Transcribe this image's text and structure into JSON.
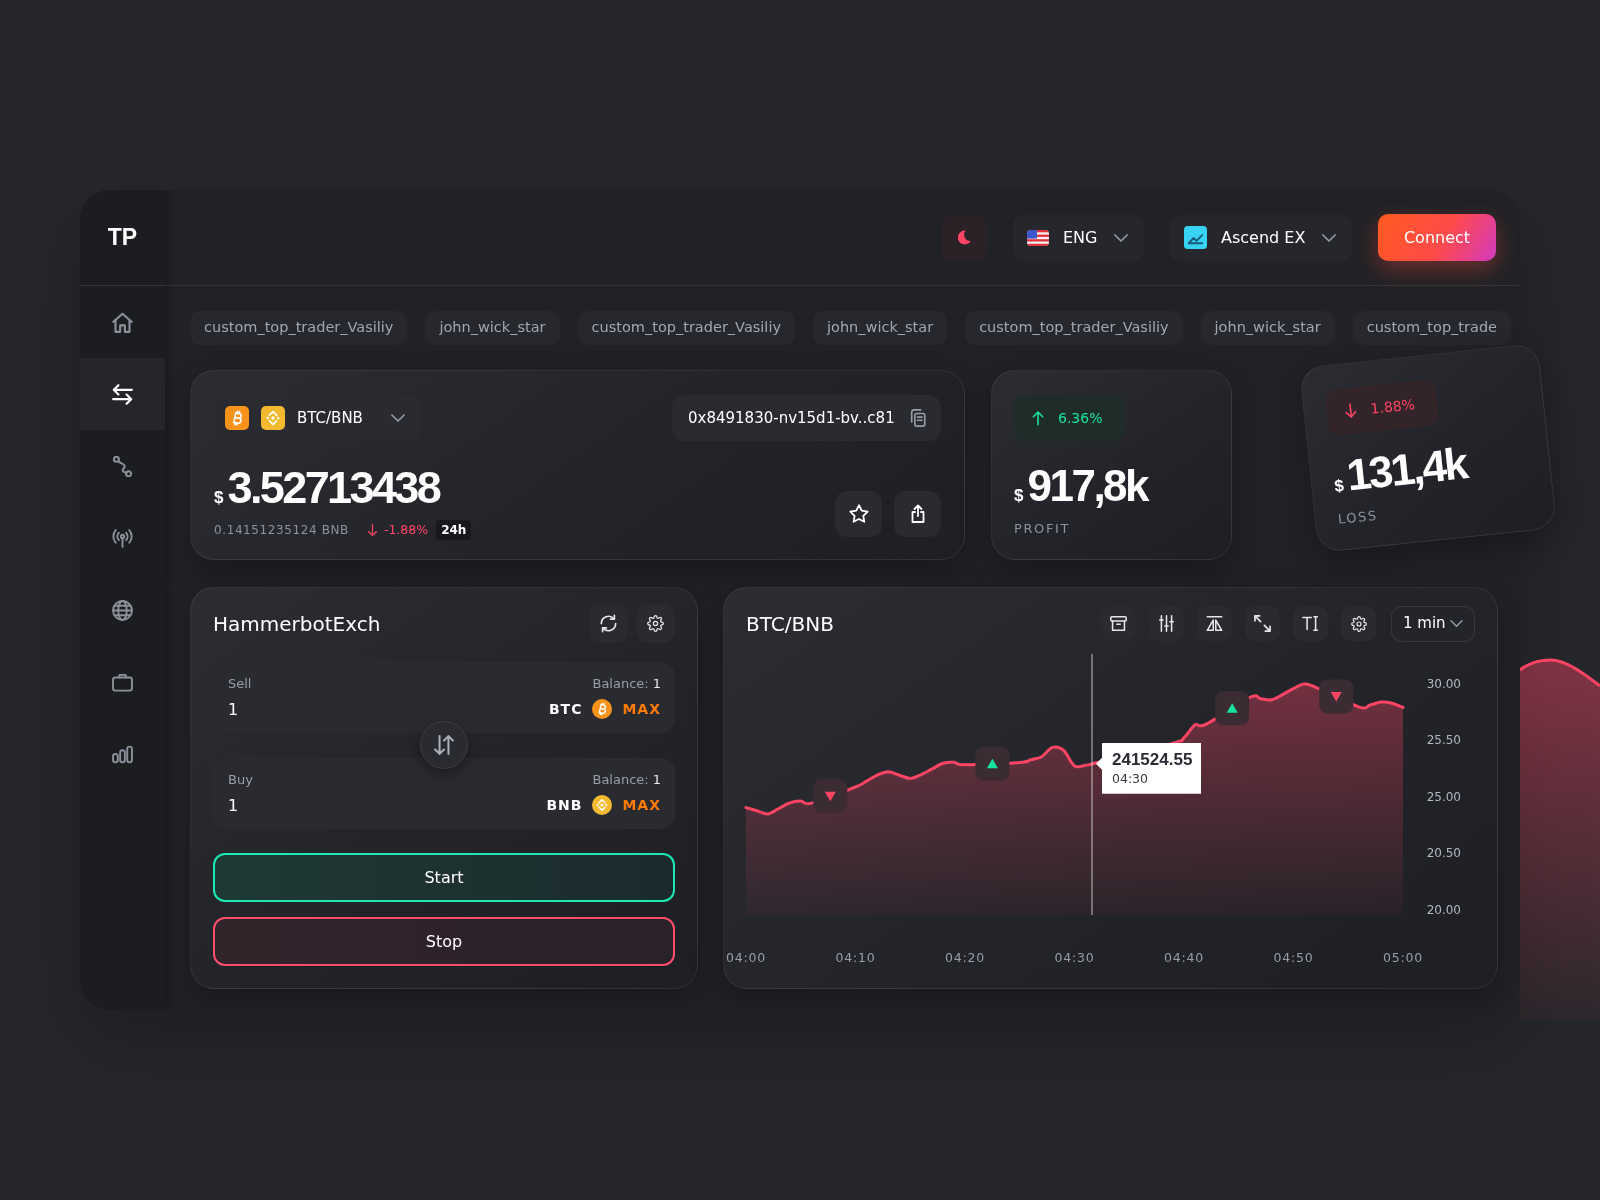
{
  "sidebar": {
    "logo": "TP",
    "items": [
      {
        "selected": false
      },
      {
        "selected": true
      },
      {
        "selected": false
      },
      {
        "selected": false
      },
      {
        "selected": false
      },
      {
        "selected": false
      },
      {
        "selected": false
      }
    ]
  },
  "header": {
    "language": "ENG",
    "exchange": "Ascend EX",
    "connect": "Connect"
  },
  "tags": [
    "custom_top_trader_Vasiliy",
    "john_wick_star",
    "custom_top_trader_Vasiliy",
    "john_wick_star",
    "custom_top_trader_Vasiliy",
    "john_wick_star",
    "custom_top_trade"
  ],
  "price_card": {
    "pair": "BTC/BNB",
    "address": "0x8491830-nv15d1-bv..c81",
    "currency": "$",
    "price": "3.52713438",
    "converted": "0.14151235124 BNB",
    "rising": false,
    "change": "-1.88%",
    "period": "24h"
  },
  "stats": [
    {
      "rising": true,
      "change": "6.36%",
      "currency": "$",
      "value": "917,8k",
      "label": "PROFIT",
      "tilted": false
    },
    {
      "rising": false,
      "change": "1.88%",
      "currency": "$",
      "value": "131,4k",
      "label": "LOSS",
      "tilted": true
    }
  ],
  "bot": {
    "title": "HammerbotExch",
    "fields": [
      {
        "label": "Sell",
        "balance_label": "Balance:",
        "balance": "1",
        "value": "1",
        "token": "BTC",
        "max": "MAX"
      },
      {
        "label": "Buy",
        "balance_label": "Balance:",
        "balance": "1",
        "value": "1",
        "token": "BNB",
        "max": "MAX"
      }
    ],
    "buttons": [
      {
        "label": "Start",
        "kind": "success"
      },
      {
        "label": "Stop",
        "kind": "danger"
      }
    ]
  },
  "chart": {
    "interval": "1 min",
    "y_between_labels": [
      "25.50",
      "20.50"
    ],
    "tooltip": {
      "value": "241524.55",
      "time": "04:30"
    },
    "markers": [
      {
        "rising": false
      },
      {
        "rising": true
      },
      {
        "rising": true
      },
      {
        "rising": false
      }
    ],
    "chart_data": {
      "type": "area",
      "title": "BTC/BNB",
      "categories": [
        "04:00",
        null,
        null,
        null,
        null,
        null,
        null,
        null,
        null,
        null,
        "04:10",
        null,
        null,
        null,
        null,
        null,
        null,
        null,
        null,
        null,
        "04:20",
        null,
        null,
        null,
        null,
        null,
        null,
        null,
        null,
        null,
        "04:30",
        null,
        null,
        null,
        null,
        null,
        null,
        null,
        null,
        null,
        "04:40",
        null,
        null,
        null,
        null,
        null,
        null,
        null,
        null,
        null,
        "04:50",
        null,
        null,
        null,
        null,
        null,
        null,
        null,
        null,
        null,
        "05:00"
      ],
      "series": [
        {
          "color": "#ff4565",
          "values": [
            24.52,
            24.38,
            24.24,
            24.48,
            24.73,
            24.81,
            24.72,
            null,
            null,
            null,
            25.43,
            25.69,
            25.96,
            26.1,
            25.95,
            25.81,
            25.98,
            26.23,
            26.48,
            26.52,
            26.41,
            null,
            null,
            null,
            null,
            26.51,
            26.63,
            26.77,
            27.18,
            27.05,
            26.36,
            26.39,
            26.5,
            null,
            null,
            null,
            null,
            null,
            null,
            27.37,
            27.61,
            28.17,
            28.2,
            null,
            null,
            null,
            29.38,
            29.33,
            29.28,
            29.51,
            29.78,
            29.98,
            29.84,
            null,
            null,
            null,
            28.96,
            29.05,
            29.18,
            29.13,
            28.94
          ]
        }
      ],
      "ylim": [
        20,
        30
      ],
      "yticks": [
        {
          "value": 30,
          "label": "30.00"
        },
        {
          "value": 25,
          "label": "25.00"
        },
        {
          "value": 20,
          "label": "20.00"
        }
      ]
    }
  }
}
